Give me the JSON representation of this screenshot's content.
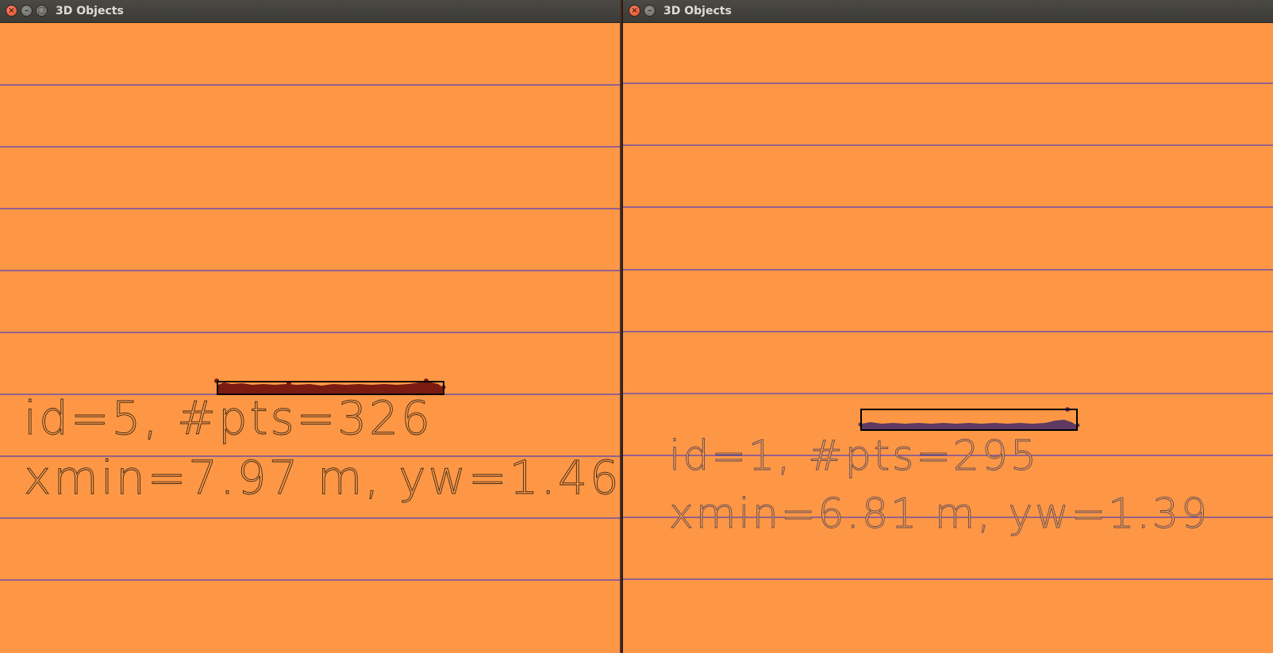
{
  "windows": {
    "left": {
      "title": "3D Objects",
      "label_line1": "id=5, #pts=326",
      "label_line2": "xmin=7.97 m, yw=1.46",
      "object_color": "#7a1b12"
    },
    "right": {
      "title": "3D Objects",
      "label_line1": "id=1, #pts=295",
      "label_line2": "xmin=6.81 m, yw=1.39",
      "object_color": "#5e3a63"
    }
  },
  "colors": {
    "canvas_background": "#fd9745",
    "grid_line": "#2b2bd6",
    "bounding_box": "#000000",
    "label_text": "#3a2a1a"
  },
  "icons": [
    "close-icon",
    "minimize-icon",
    "maximize-icon"
  ]
}
